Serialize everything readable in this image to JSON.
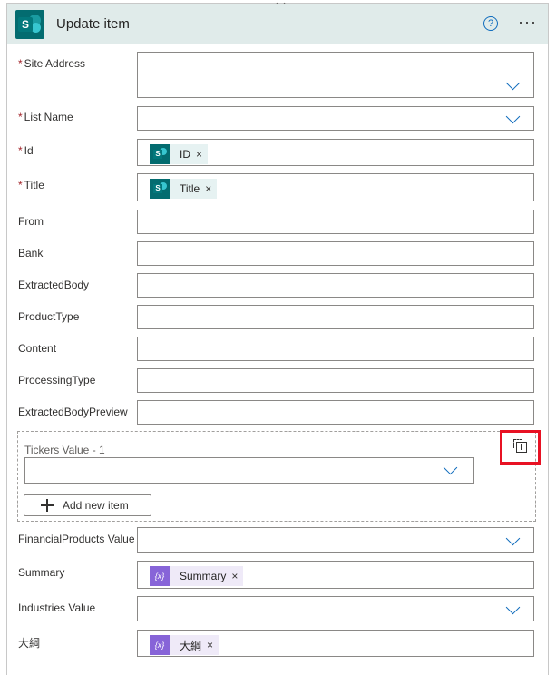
{
  "header": {
    "title": "Update item",
    "help_icon": "question-circle-icon",
    "more_icon": "more-horizontal-icon"
  },
  "fields": {
    "site_address": {
      "label": "Site Address",
      "required": true
    },
    "list_name": {
      "label": "List Name",
      "required": true
    },
    "id": {
      "label": "Id",
      "required": true,
      "token": "ID"
    },
    "title": {
      "label": "Title",
      "required": true,
      "token": "Title"
    },
    "from": {
      "label": "From"
    },
    "bank": {
      "label": "Bank"
    },
    "extracted_body": {
      "label": "ExtractedBody"
    },
    "product_type": {
      "label": "ProductType"
    },
    "content": {
      "label": "Content"
    },
    "processing_type": {
      "label": "ProcessingType"
    },
    "extracted_body_preview": {
      "label": "ExtractedBodyPreview"
    },
    "tickers": {
      "label": "Tickers Value - 1",
      "add_label": "Add new item"
    },
    "financial_products": {
      "label": "FinancialProducts Value"
    },
    "summary": {
      "label": "Summary",
      "token": "Summary"
    },
    "industries": {
      "label": "Industries Value"
    },
    "outline": {
      "label": "大綱",
      "token": "大綱"
    }
  },
  "required_mark": "*",
  "remove_mark": "×",
  "colors": {
    "header_bg": "#e0ebea",
    "sharepoint": "#036c70",
    "expression": "#8764d8",
    "accent": "#0f6cbd",
    "highlight": "#e81123"
  }
}
